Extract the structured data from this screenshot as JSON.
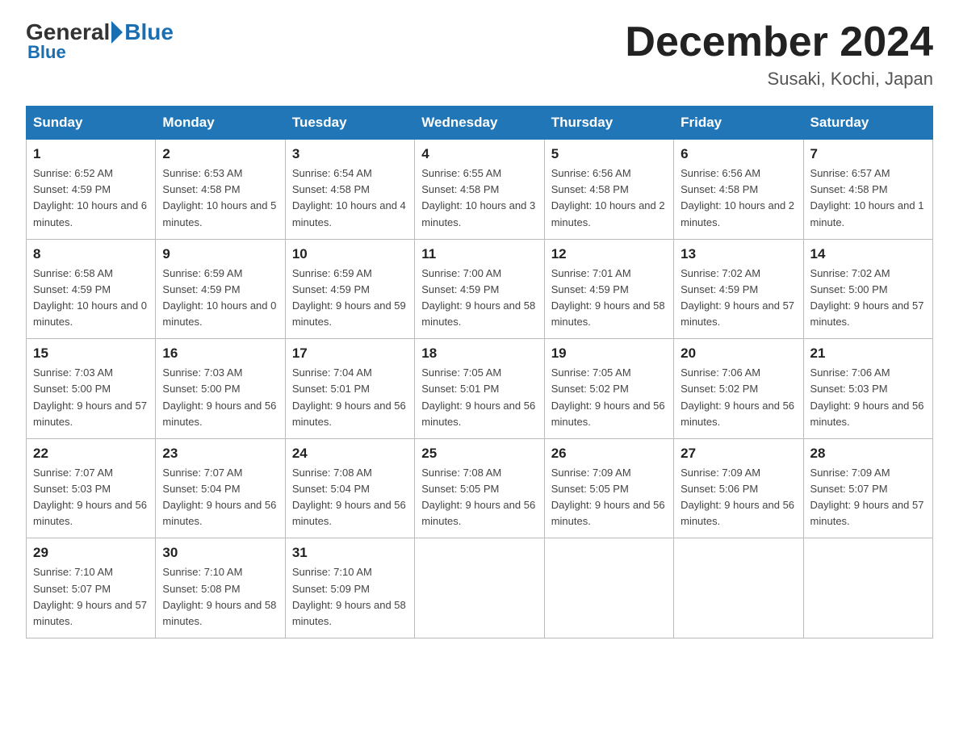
{
  "header": {
    "logo_general": "General",
    "logo_blue": "Blue",
    "month_title": "December 2024",
    "location": "Susaki, Kochi, Japan"
  },
  "weekdays": [
    "Sunday",
    "Monday",
    "Tuesday",
    "Wednesday",
    "Thursday",
    "Friday",
    "Saturday"
  ],
  "weeks": [
    [
      {
        "day": "1",
        "sunrise": "6:52 AM",
        "sunset": "4:59 PM",
        "daylight": "10 hours and 6 minutes."
      },
      {
        "day": "2",
        "sunrise": "6:53 AM",
        "sunset": "4:58 PM",
        "daylight": "10 hours and 5 minutes."
      },
      {
        "day": "3",
        "sunrise": "6:54 AM",
        "sunset": "4:58 PM",
        "daylight": "10 hours and 4 minutes."
      },
      {
        "day": "4",
        "sunrise": "6:55 AM",
        "sunset": "4:58 PM",
        "daylight": "10 hours and 3 minutes."
      },
      {
        "day": "5",
        "sunrise": "6:56 AM",
        "sunset": "4:58 PM",
        "daylight": "10 hours and 2 minutes."
      },
      {
        "day": "6",
        "sunrise": "6:56 AM",
        "sunset": "4:58 PM",
        "daylight": "10 hours and 2 minutes."
      },
      {
        "day": "7",
        "sunrise": "6:57 AM",
        "sunset": "4:58 PM",
        "daylight": "10 hours and 1 minute."
      }
    ],
    [
      {
        "day": "8",
        "sunrise": "6:58 AM",
        "sunset": "4:59 PM",
        "daylight": "10 hours and 0 minutes."
      },
      {
        "day": "9",
        "sunrise": "6:59 AM",
        "sunset": "4:59 PM",
        "daylight": "10 hours and 0 minutes."
      },
      {
        "day": "10",
        "sunrise": "6:59 AM",
        "sunset": "4:59 PM",
        "daylight": "9 hours and 59 minutes."
      },
      {
        "day": "11",
        "sunrise": "7:00 AM",
        "sunset": "4:59 PM",
        "daylight": "9 hours and 58 minutes."
      },
      {
        "day": "12",
        "sunrise": "7:01 AM",
        "sunset": "4:59 PM",
        "daylight": "9 hours and 58 minutes."
      },
      {
        "day": "13",
        "sunrise": "7:02 AM",
        "sunset": "4:59 PM",
        "daylight": "9 hours and 57 minutes."
      },
      {
        "day": "14",
        "sunrise": "7:02 AM",
        "sunset": "5:00 PM",
        "daylight": "9 hours and 57 minutes."
      }
    ],
    [
      {
        "day": "15",
        "sunrise": "7:03 AM",
        "sunset": "5:00 PM",
        "daylight": "9 hours and 57 minutes."
      },
      {
        "day": "16",
        "sunrise": "7:03 AM",
        "sunset": "5:00 PM",
        "daylight": "9 hours and 56 minutes."
      },
      {
        "day": "17",
        "sunrise": "7:04 AM",
        "sunset": "5:01 PM",
        "daylight": "9 hours and 56 minutes."
      },
      {
        "day": "18",
        "sunrise": "7:05 AM",
        "sunset": "5:01 PM",
        "daylight": "9 hours and 56 minutes."
      },
      {
        "day": "19",
        "sunrise": "7:05 AM",
        "sunset": "5:02 PM",
        "daylight": "9 hours and 56 minutes."
      },
      {
        "day": "20",
        "sunrise": "7:06 AM",
        "sunset": "5:02 PM",
        "daylight": "9 hours and 56 minutes."
      },
      {
        "day": "21",
        "sunrise": "7:06 AM",
        "sunset": "5:03 PM",
        "daylight": "9 hours and 56 minutes."
      }
    ],
    [
      {
        "day": "22",
        "sunrise": "7:07 AM",
        "sunset": "5:03 PM",
        "daylight": "9 hours and 56 minutes."
      },
      {
        "day": "23",
        "sunrise": "7:07 AM",
        "sunset": "5:04 PM",
        "daylight": "9 hours and 56 minutes."
      },
      {
        "day": "24",
        "sunrise": "7:08 AM",
        "sunset": "5:04 PM",
        "daylight": "9 hours and 56 minutes."
      },
      {
        "day": "25",
        "sunrise": "7:08 AM",
        "sunset": "5:05 PM",
        "daylight": "9 hours and 56 minutes."
      },
      {
        "day": "26",
        "sunrise": "7:09 AM",
        "sunset": "5:05 PM",
        "daylight": "9 hours and 56 minutes."
      },
      {
        "day": "27",
        "sunrise": "7:09 AM",
        "sunset": "5:06 PM",
        "daylight": "9 hours and 56 minutes."
      },
      {
        "day": "28",
        "sunrise": "7:09 AM",
        "sunset": "5:07 PM",
        "daylight": "9 hours and 57 minutes."
      }
    ],
    [
      {
        "day": "29",
        "sunrise": "7:10 AM",
        "sunset": "5:07 PM",
        "daylight": "9 hours and 57 minutes."
      },
      {
        "day": "30",
        "sunrise": "7:10 AM",
        "sunset": "5:08 PM",
        "daylight": "9 hours and 58 minutes."
      },
      {
        "day": "31",
        "sunrise": "7:10 AM",
        "sunset": "5:09 PM",
        "daylight": "9 hours and 58 minutes."
      },
      null,
      null,
      null,
      null
    ]
  ],
  "labels": {
    "sunrise": "Sunrise:",
    "sunset": "Sunset:",
    "daylight": "Daylight:"
  }
}
